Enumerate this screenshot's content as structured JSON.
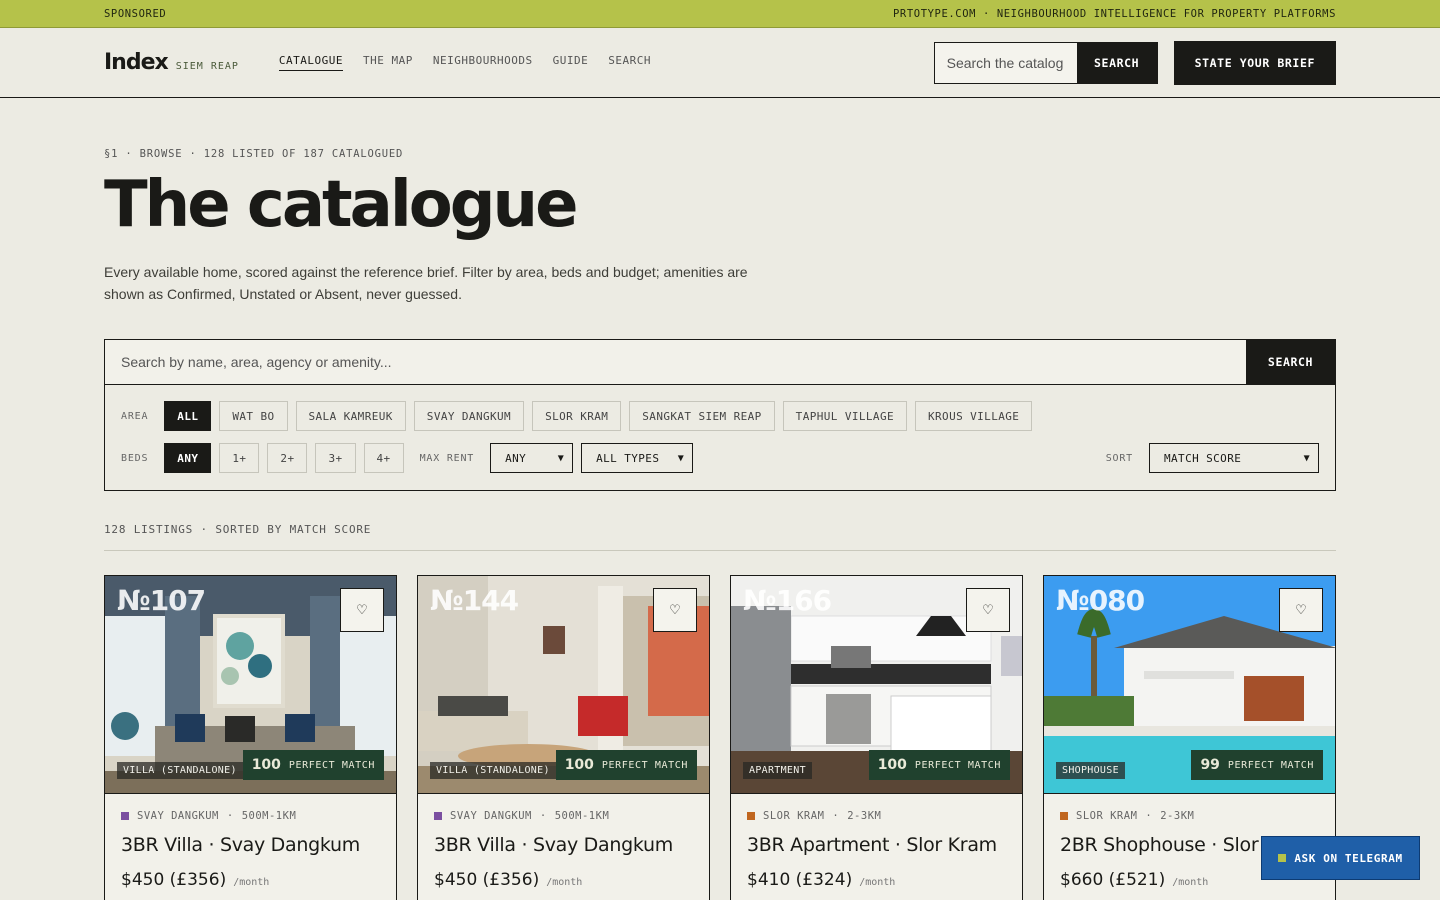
{
  "topbar": {
    "left": "SPONSORED",
    "right": "PRTOTYPE.COM · NEIGHBOURHOOD INTELLIGENCE FOR PROPERTY PLATFORMS"
  },
  "header": {
    "logo": "Index",
    "logo_sub": "SIEM REAP",
    "nav": [
      {
        "label": "CATALOGUE"
      },
      {
        "label": "THE MAP"
      },
      {
        "label": "NEIGHBOURHOODS"
      },
      {
        "label": "GUIDE"
      },
      {
        "label": "SEARCH"
      }
    ],
    "search_placeholder": "Search the catalog",
    "search_button": "SEARCH",
    "brief_button": "STATE YOUR BRIEF"
  },
  "hero": {
    "eyebrow": "§1 · BROWSE · 128 LISTED OF 187 CATALOGUED",
    "title": "The catalogue",
    "lede": "Every available home, scored against the reference brief. Filter by area, beds and budget; amenities are shown as Confirmed, Unstated or Absent, never guessed."
  },
  "filters": {
    "search_placeholder": "Search by name, area, agency or amenity...",
    "search_button": "SEARCH",
    "area_label": "AREA",
    "areas": [
      "ALL",
      "WAT BO",
      "SALA KAMREUK",
      "SVAY DANGKUM",
      "SLOR KRAM",
      "SANGKAT SIEM REAP",
      "TAPHUL VILLAGE",
      "KROUS VILLAGE"
    ],
    "beds_label": "BEDS",
    "beds": [
      "ANY",
      "1+",
      "2+",
      "3+",
      "4+"
    ],
    "rent_label": "MAX RENT",
    "rent_value": "ANY",
    "type_value": "ALL TYPES",
    "sort_label": "SORT",
    "sort_value": "MATCH SCORE"
  },
  "listing_count": "128 LISTINGS · SORTED BY MATCH SCORE",
  "cards": [
    {
      "num": "№107",
      "type": "VILLA (STANDALONE)",
      "score": "100",
      "match_label": "PERFECT MATCH",
      "area": "SVAY DANGKUM",
      "distance": "500M-1KM",
      "title": "3BR Villa · Svay Dangkum",
      "price": "$450 (£356)",
      "period": "/month",
      "color": "#7b4fa0"
    },
    {
      "num": "№144",
      "type": "VILLA (STANDALONE)",
      "score": "100",
      "match_label": "PERFECT MATCH",
      "area": "SVAY DANGKUM",
      "distance": "500M-1KM",
      "title": "3BR Villa · Svay Dangkum",
      "price": "$450 (£356)",
      "period": "/month",
      "color": "#7b4fa0"
    },
    {
      "num": "№166",
      "type": "APARTMENT",
      "score": "100",
      "match_label": "PERFECT MATCH",
      "area": "SLOR KRAM",
      "distance": "2-3KM",
      "title": "3BR Apartment · Slor Kram",
      "price": "$410 (£324)",
      "period": "/month",
      "color": "#c0661f"
    },
    {
      "num": "№080",
      "type": "SHOPHOUSE",
      "score": "99",
      "match_label": "PERFECT MATCH",
      "area": "SLOR KRAM",
      "distance": "2-3KM",
      "title": "2BR Shophouse · Slor Kram",
      "price": "$660 (£521)",
      "period": "/month",
      "color": "#c0661f"
    }
  ],
  "telegram": "ASK ON TELEGRAM",
  "icons": {
    "fav": "heart-icon",
    "chevron": "chevron-down-icon"
  }
}
